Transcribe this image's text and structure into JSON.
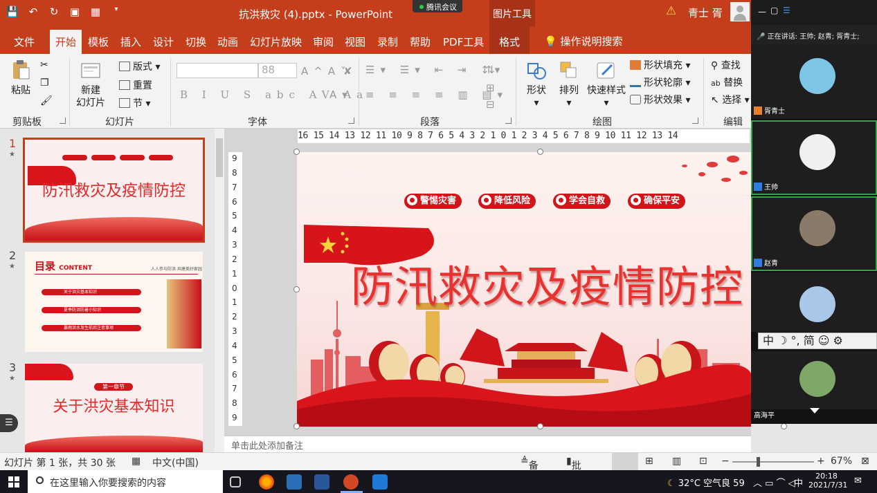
{
  "window": {
    "title": "抗洪救灾 (4).pptx  -  PowerPoint",
    "context_tools": "图片工具",
    "meeting_badge": "腾讯会议",
    "user": "青士 胥"
  },
  "tabs": [
    "文件",
    "开始",
    "模板",
    "插入",
    "设计",
    "切换",
    "动画",
    "幻灯片放映",
    "审阅",
    "视图",
    "录制",
    "帮助",
    "PDF工具",
    "格式"
  ],
  "active_tab": "开始",
  "tell_me": "操作说明搜索",
  "ribbon": {
    "clipboard": {
      "paste": "粘贴",
      "label": "剪贴板"
    },
    "slides": {
      "new_slide_line1": "新建",
      "new_slide_line2": "幻灯片",
      "layout": "版式",
      "reset": "重置",
      "section": "节",
      "label": "幻灯片"
    },
    "font": {
      "size": "88",
      "label": "字体"
    },
    "paragraph": {
      "label": "段落"
    },
    "drawing": {
      "shapes": "形状",
      "arrange": "排列",
      "quick_styles": "快速样式",
      "shape_fill": "形状填充",
      "shape_outline": "形状轮廓",
      "shape_effects": "形状效果",
      "label": "绘图"
    },
    "editing": {
      "find": "查找",
      "replace": "替换",
      "select": "选择",
      "label": "编辑"
    }
  },
  "ruler": {
    "horizontal": "16 15 14 13 12 11 10 9 8 7 6 5 4 3 2 1 0 1 2 3 4 5 6 7 8 9 10 11 12 13 14",
    "vertical": [
      "9",
      "8",
      "7",
      "6",
      "5",
      "4",
      "3",
      "2",
      "1",
      "0",
      "1",
      "2",
      "3",
      "4",
      "5",
      "6",
      "7",
      "8",
      "9"
    ]
  },
  "thumbnails": [
    {
      "num": "1",
      "title": "防汛救灾及疫情防控",
      "selected": true
    },
    {
      "num": "2",
      "title": "目录",
      "title_en": "CONTENT",
      "subtitle": "人人参与防洪 共建美好家园",
      "items": [
        "关于洪灾基本知识",
        "夏季防洪防暑小知识",
        "暴雨洪水发生前后注意事项"
      ]
    },
    {
      "num": "3",
      "title": "关于洪灾基本知识",
      "badge": "第一章节"
    }
  ],
  "slide": {
    "pills": [
      "警惕灾害",
      "降低风险",
      "学会自救",
      "确保平安"
    ],
    "title": "防汛救灾及疫情防控"
  },
  "notes_placeholder": "单击此处添加备注",
  "status": {
    "slide_info": "幻灯片 第 1 张，共 30 张",
    "language": "中文(中国)",
    "notes": "备注",
    "comments": "批注",
    "zoom": "67%"
  },
  "meeting": {
    "speaking": "正在讲话: 王帅; 赵青; 胥青士;",
    "participants": [
      {
        "name": "胥青士",
        "color": "#7ec6e6"
      },
      {
        "name": "王帅",
        "color": "#f0f0f0"
      },
      {
        "name": "赵青",
        "color": "#8a7a6a"
      },
      {
        "name": "",
        "color": "#a9c7e8"
      },
      {
        "name": "高海平",
        "color": "#7fa868"
      }
    ],
    "ime": "中 ☽ °, 简 ☺ ⚙"
  },
  "taskbar": {
    "search_placeholder": "在这里输入你要搜索的内容",
    "weather": "32°C 空气良 59",
    "ime": "中",
    "time": "20:18",
    "date": "2021/7/31"
  },
  "colors": {
    "accent": "#c43e1c",
    "slide_red": "#d0151b"
  }
}
